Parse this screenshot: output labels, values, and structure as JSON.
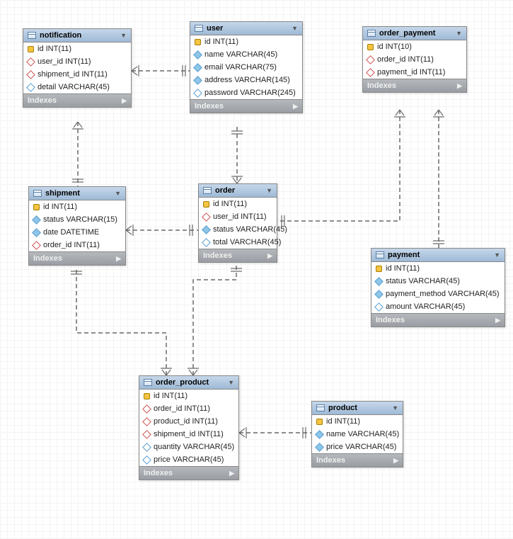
{
  "diagram_type": "Entity Relationship Diagram",
  "entities": {
    "notification": {
      "title": "notification",
      "indexes_label": "Indexes",
      "cols": [
        {
          "icon": "pk",
          "text": "id INT(11)"
        },
        {
          "icon": "fk",
          "text": "user_id INT(11)"
        },
        {
          "icon": "fk",
          "text": "shipment_id INT(11)"
        },
        {
          "icon": "at",
          "text": "detail VARCHAR(45)"
        }
      ]
    },
    "user": {
      "title": "user",
      "indexes_label": "Indexes",
      "cols": [
        {
          "icon": "pk",
          "text": "id INT(11)"
        },
        {
          "icon": "atf",
          "text": "name VARCHAR(45)"
        },
        {
          "icon": "atf",
          "text": "email VARCHAR(75)"
        },
        {
          "icon": "atf",
          "text": "address VARCHAR(145)"
        },
        {
          "icon": "at",
          "text": "password VARCHAR(245)"
        }
      ]
    },
    "order_payment": {
      "title": "order_payment",
      "indexes_label": "Indexes",
      "cols": [
        {
          "icon": "pk",
          "text": "id INT(10)"
        },
        {
          "icon": "fk",
          "text": "order_id INT(11)"
        },
        {
          "icon": "fk",
          "text": "payment_id INT(11)"
        }
      ]
    },
    "shipment": {
      "title": "shipment",
      "indexes_label": "Indexes",
      "cols": [
        {
          "icon": "pk",
          "text": "id INT(11)"
        },
        {
          "icon": "atf",
          "text": "status VARCHAR(15)"
        },
        {
          "icon": "atf",
          "text": "date DATETIME"
        },
        {
          "icon": "fk",
          "text": "order_id INT(11)"
        }
      ]
    },
    "order": {
      "title": "order",
      "indexes_label": "Indexes",
      "cols": [
        {
          "icon": "pk",
          "text": "id INT(11)"
        },
        {
          "icon": "fk",
          "text": "user_id INT(11)"
        },
        {
          "icon": "atf",
          "text": "status VARCHAR(45)"
        },
        {
          "icon": "at",
          "text": "total VARCHAR(45)"
        }
      ]
    },
    "payment": {
      "title": "payment",
      "indexes_label": "Indexes",
      "cols": [
        {
          "icon": "pk",
          "text": "id INT(11)"
        },
        {
          "icon": "atf",
          "text": "status VARCHAR(45)"
        },
        {
          "icon": "atf",
          "text": "payment_method VARCHAR(45)"
        },
        {
          "icon": "at",
          "text": "amount VARCHAR(45)"
        }
      ]
    },
    "order_product": {
      "title": "order_product",
      "indexes_label": "Indexes",
      "cols": [
        {
          "icon": "pk",
          "text": "id INT(11)"
        },
        {
          "icon": "fk",
          "text": "order_id INT(11)"
        },
        {
          "icon": "fk",
          "text": "product_id INT(11)"
        },
        {
          "icon": "fk",
          "text": "shipment_id INT(11)"
        },
        {
          "icon": "at",
          "text": "quantity VARCHAR(45)"
        },
        {
          "icon": "at",
          "text": "price VARCHAR(45)"
        }
      ]
    },
    "product": {
      "title": "product",
      "indexes_label": "Indexes",
      "cols": [
        {
          "icon": "pk",
          "text": "id INT(11)"
        },
        {
          "icon": "atf",
          "text": "name VARCHAR(45)"
        },
        {
          "icon": "atf",
          "text": "price VARCHAR(45)"
        }
      ]
    }
  },
  "relationships": [
    {
      "from": "notification",
      "to": "user",
      "type": "many-to-one"
    },
    {
      "from": "notification",
      "to": "shipment",
      "type": "many-to-one"
    },
    {
      "from": "order",
      "to": "user",
      "type": "many-to-one"
    },
    {
      "from": "shipment",
      "to": "order",
      "type": "many-to-one"
    },
    {
      "from": "order_payment",
      "to": "order",
      "type": "many-to-one"
    },
    {
      "from": "order_payment",
      "to": "payment",
      "type": "many-to-one"
    },
    {
      "from": "order_product",
      "to": "order",
      "type": "many-to-one"
    },
    {
      "from": "order_product",
      "to": "shipment",
      "type": "many-to-one"
    },
    {
      "from": "order_product",
      "to": "product",
      "type": "many-to-one"
    }
  ]
}
